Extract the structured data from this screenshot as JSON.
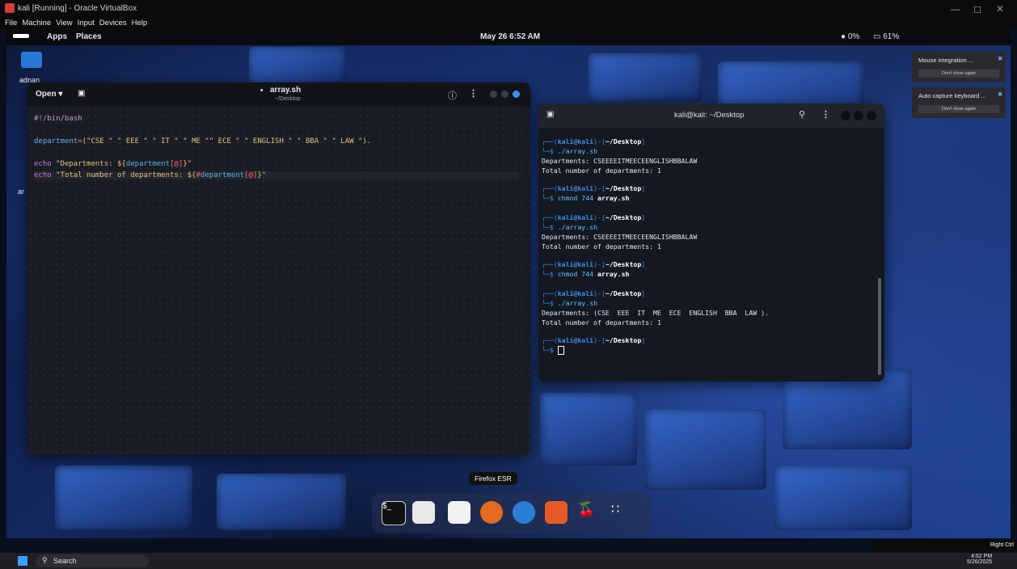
{
  "host": {
    "title": "kali [Running] - Oracle VirtualBox",
    "menu": [
      "File",
      "Machine",
      "View",
      "Input",
      "Devices",
      "Help"
    ],
    "right_ctrl": "Right Ctrl"
  },
  "guest_topbar": {
    "apps": "Apps",
    "places": "Places",
    "datetime": "May 26  6:52 AM",
    "cpu": "0%",
    "battery": "61%"
  },
  "desktop_icons": {
    "home_label": "adnan",
    "array_label": "ar"
  },
  "editor": {
    "open_label": "Open",
    "filename": "array.sh",
    "path": "~/Desktop",
    "lines": {
      "l1": "#!/bin/bash",
      "l2_var": "department",
      "l2_eq": "=",
      "l2_rest": "(\"CSE \" \" EEE \" \" IT \" \" ME \"\" ECE \" \" ENGLISH \" \" BBA \" \" LAW \").",
      "l3_kw": "echo",
      "l3_str1": " \"Departments: ${",
      "l3_var": "department",
      "l3_sym": "[@]",
      "l3_str2": "}\"",
      "l4_kw": "echo",
      "l4_str1": " \"Total number of departments: ${",
      "l4_hash": "#",
      "l4_var": "department",
      "l4_sym": "[@]",
      "l4_str2": "}\""
    }
  },
  "terminal": {
    "title": "kali@kali: ~/Desktop",
    "prompt_user": "kali",
    "prompt_host": "kali",
    "prompt_dir": "~/Desktop",
    "cmd_run": "./array.sh",
    "cmd_chmod": "chmod 744",
    "chmod_file": "array.sh",
    "out_dep1": "Departments: CSEEEEITMEECEENGLISHBBALAW",
    "out_total": "Total number of departments: 1",
    "out_dep2": "Departments: CSEEEEITMEECEENGLISHBBALAW",
    "out_dep3": "Departments: (CSE  EEE  IT  ME  ECE  ENGLISH  BBA  LAW ).",
    "prompt_at": "@",
    "prompt_open": "┌──(",
    "prompt_close": ")-[",
    "prompt_end": "]",
    "prompt_dollar": "└─$ "
  },
  "notifications": [
    {
      "title": "Mouse integration ...",
      "button": "Don't show again"
    },
    {
      "title": "Auto capture keyboard ...",
      "button": "Don't show again"
    }
  ],
  "dock_tooltip": "Firefox ESR",
  "taskbar": {
    "search": "Search",
    "time": "4:52 PM",
    "date": "5/26/2025"
  },
  "colors": {
    "accent": "#3b8eea",
    "editor_bg": "#1a1c24",
    "terminal_bg": "#141821"
  }
}
